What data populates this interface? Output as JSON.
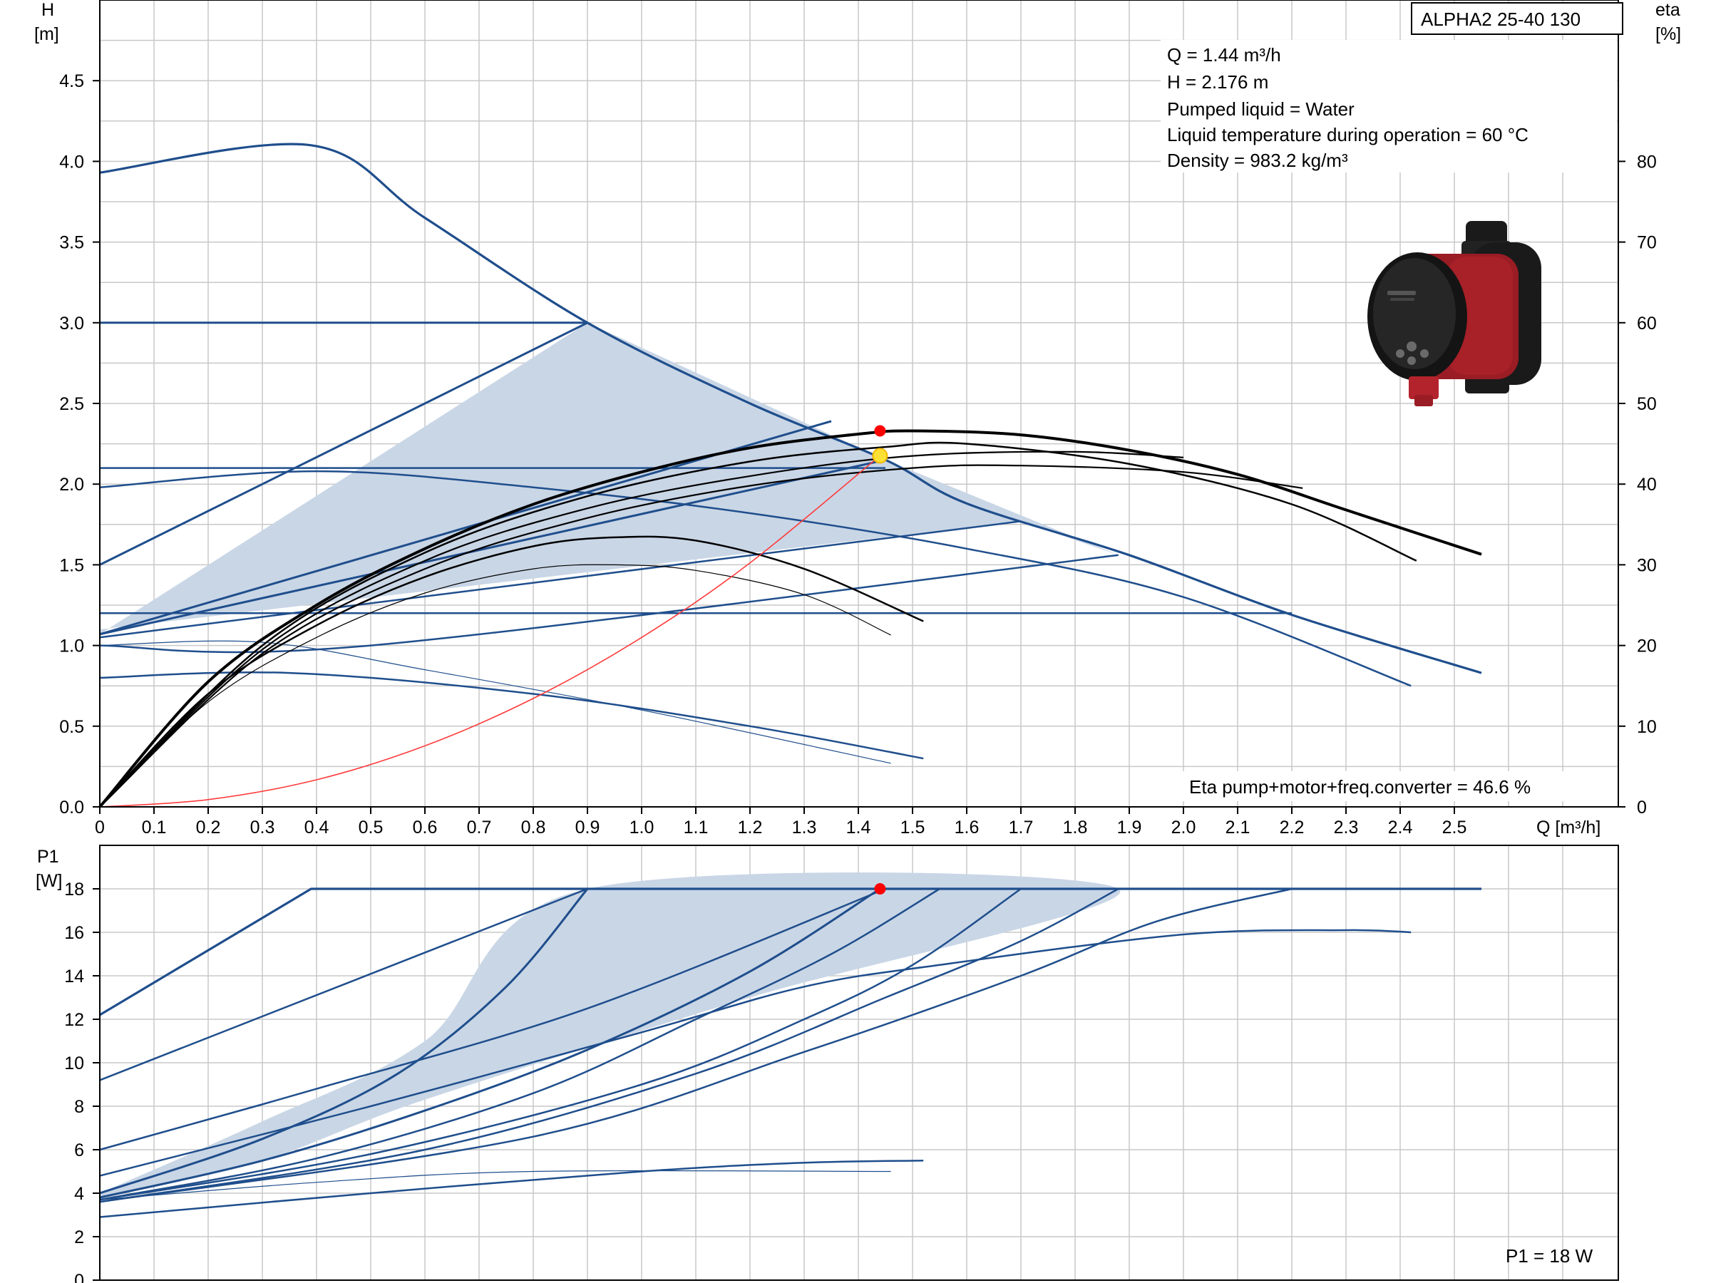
{
  "model_label": "ALPHA2 25-40 130",
  "info_lines": [
    "Q = 1.44 m³/h",
    "H = 2.176 m",
    "Pumped liquid = Water",
    "Liquid temperature during operation = 60 °C",
    "Density = 983.2 kg/m³"
  ],
  "eta_note": "Eta pump+motor+freq.converter = 46.6 %",
  "p1_note": "P1 = 18 W",
  "colors": {
    "curve_blue": "#1f4e8c",
    "shade_fill": "#c9d6e6",
    "eta_black": "#000000",
    "system_red": "#ff3b3b",
    "point_red": "#ff0000",
    "point_yellow": "#ffe135",
    "grid": "#c8c8c8"
  },
  "pump_image": {
    "icon": "circulator-pump-image",
    "body_color": "#9a1c24",
    "housing_color": "#1a1a1a"
  },
  "chart_data": [
    {
      "type": "line",
      "name": "head",
      "ylabel_line1": "H",
      "ylabel_line2": "[m]",
      "y2label_line1": "eta",
      "y2label_line2": "[%]",
      "xlabel": "Q [m³/h]",
      "xlim": [
        0,
        2.8
      ],
      "ylim": [
        0,
        5.0
      ],
      "y2lim": [
        0,
        100
      ],
      "xticks": [
        0,
        0.1,
        0.2,
        0.3,
        0.4,
        0.5,
        0.6,
        0.7,
        0.8,
        0.9,
        1.0,
        1.1,
        1.2,
        1.3,
        1.4,
        1.5,
        1.6,
        1.7,
        1.8,
        1.9,
        2.0,
        2.1,
        2.2,
        2.3,
        2.4,
        2.5
      ],
      "xtick_labels": [
        "0",
        "0.1",
        "0.2",
        "0.3",
        "0.4",
        "0.5",
        "0.6",
        "0.7",
        "0.8",
        "0.9",
        "1.0",
        "1.1",
        "1.2",
        "1.3",
        "1.4",
        "1.5",
        "1.6",
        "1.7",
        "1.8",
        "1.9",
        "2.0",
        "2.1",
        "2.2",
        "2.3",
        "2.4",
        "2.5"
      ],
      "yticks": [
        0,
        0.5,
        1.0,
        1.5,
        2.0,
        2.5,
        3.0,
        3.5,
        4.0,
        4.5
      ],
      "ytick_labels": [
        "0.0",
        "0.5",
        "1.0",
        "1.5",
        "2.0",
        "2.5",
        "3.0",
        "3.5",
        "4.0",
        "4.5"
      ],
      "y2ticks": [
        0,
        10,
        20,
        30,
        40,
        50,
        60,
        70,
        80
      ],
      "y2tick_labels": [
        "0",
        "10",
        "20",
        "30",
        "40",
        "50",
        "60",
        "70",
        "80"
      ],
      "shaded_region": [
        [
          0,
          1.07
        ],
        [
          0.9,
          3.0
        ],
        [
          1.45,
          2.15
        ],
        [
          1.88,
          1.56
        ],
        [
          1.7,
          1.77
        ],
        [
          0,
          1.1
        ]
      ],
      "pump_curves": [
        {
          "name": "max",
          "width": 3.2,
          "points": [
            [
              0,
              3.93
            ],
            [
              0.39,
              4.1
            ],
            [
              0.6,
              3.65
            ],
            [
              0.9,
              3.0
            ],
            [
              1.2,
              2.5
            ],
            [
              1.45,
              2.15
            ],
            [
              1.6,
              1.88
            ],
            [
              1.9,
              1.56
            ],
            [
              2.2,
              1.19
            ],
            [
              2.55,
              0.83
            ]
          ]
        },
        {
          "name": "pp",
          "width": 3,
          "points": [
            [
              0,
              1.5
            ],
            [
              0.9,
              3.0
            ]
          ]
        },
        {
          "name": "pp",
          "width": 3,
          "points": [
            [
              0,
              1.07
            ],
            [
              1.35,
              2.39
            ]
          ]
        },
        {
          "name": "pp",
          "width": 3,
          "points": [
            [
              0,
              1.07
            ],
            [
              1.45,
              2.15
            ]
          ]
        },
        {
          "name": "pp",
          "width": 2.5,
          "points": [
            [
              0,
              1.05
            ],
            [
              1.7,
              1.77
            ]
          ]
        },
        {
          "name": "pp",
          "width": 2.5,
          "points": [
            [
              0,
              1.0
            ],
            [
              0.5,
              1.0
            ],
            [
              1.88,
              1.56
            ]
          ]
        },
        {
          "name": "cp",
          "width": 3,
          "points": [
            [
              0,
              3.0
            ],
            [
              0.9,
              3.0
            ]
          ]
        },
        {
          "name": "cp",
          "width": 2.5,
          "points": [
            [
              0,
              2.1
            ],
            [
              1.45,
              2.1
            ]
          ]
        },
        {
          "name": "cp",
          "width": 2.5,
          "points": [
            [
              0,
              1.2
            ],
            [
              2.2,
              1.2
            ]
          ]
        },
        {
          "name": "cp-curve",
          "width": 2.5,
          "points": [
            [
              0,
              1.98
            ],
            [
              0.4,
              2.08
            ],
            [
              0.8,
              1.98
            ],
            [
              1.2,
              1.82
            ],
            [
              1.6,
              1.6
            ],
            [
              2.0,
              1.3
            ],
            [
              2.42,
              0.75
            ]
          ]
        },
        {
          "name": "min",
          "width": 2.5,
          "points": [
            [
              0,
              0.8
            ],
            [
              0.35,
              0.83
            ],
            [
              0.8,
              0.7
            ],
            [
              1.2,
              0.5
            ],
            [
              1.52,
              0.3
            ]
          ]
        },
        {
          "name": "min-thin",
          "width": 1.2,
          "points": [
            [
              0,
              1.0
            ],
            [
              0.3,
              1.02
            ],
            [
              0.6,
              0.85
            ],
            [
              1.0,
              0.6
            ],
            [
              1.46,
              0.27
            ]
          ]
        }
      ],
      "eta_curves": [
        {
          "width": 4,
          "points": [
            [
              0,
              0
            ],
            [
              0.2,
              15.5
            ],
            [
              0.4,
              25
            ],
            [
              0.6,
              32
            ],
            [
              0.8,
              37.5
            ],
            [
              1.0,
              41.5
            ],
            [
              1.2,
              44.5
            ],
            [
              1.4,
              46.2
            ],
            [
              1.5,
              46.6
            ],
            [
              1.7,
              46.1
            ],
            [
              1.9,
              44.2
            ],
            [
              2.1,
              41.2
            ],
            [
              2.3,
              36.8
            ],
            [
              2.55,
              31.3
            ]
          ]
        },
        {
          "width": 2.5,
          "points": [
            [
              0,
              0
            ],
            [
              0.3,
              20
            ],
            [
              0.6,
              31.5
            ],
            [
              0.9,
              38.5
            ],
            [
              1.2,
              42.8
            ],
            [
              1.45,
              44.6
            ],
            [
              1.6,
              45
            ],
            [
              1.9,
              42.5
            ],
            [
              2.2,
              37.5
            ],
            [
              2.43,
              30.5
            ]
          ]
        },
        {
          "width": 2.2,
          "points": [
            [
              0,
              0
            ],
            [
              0.3,
              19.5
            ],
            [
              0.6,
              30.5
            ],
            [
              0.9,
              37
            ],
            [
              1.2,
              41
            ],
            [
              1.5,
              43.5
            ],
            [
              1.8,
              44
            ],
            [
              2.0,
              43.3
            ]
          ]
        },
        {
          "width": 2.2,
          "points": [
            [
              0,
              0
            ],
            [
              0.3,
              19
            ],
            [
              0.6,
              29.5
            ],
            [
              0.9,
              35.8
            ],
            [
              1.2,
              39.8
            ],
            [
              1.5,
              42
            ],
            [
              1.7,
              42.3
            ],
            [
              2.0,
              41.5
            ],
            [
              2.22,
              39.5
            ]
          ]
        },
        {
          "width": 2.5,
          "points": [
            [
              0,
              0
            ],
            [
              0.2,
              14
            ],
            [
              0.4,
              22.5
            ],
            [
              0.6,
              28.5
            ],
            [
              0.8,
              32.3
            ],
            [
              0.95,
              33.4
            ],
            [
              1.1,
              33
            ],
            [
              1.3,
              29.5
            ],
            [
              1.52,
              23
            ]
          ]
        },
        {
          "width": 1.2,
          "points": [
            [
              0,
              0
            ],
            [
              0.2,
              13
            ],
            [
              0.4,
              21
            ],
            [
              0.6,
              26.5
            ],
            [
              0.8,
              29.5
            ],
            [
              0.95,
              30
            ],
            [
              1.1,
              29.3
            ],
            [
              1.3,
              26.3
            ],
            [
              1.46,
              21.3
            ]
          ]
        }
      ],
      "system_curve": [
        [
          0,
          0
        ],
        [
          0.2,
          0.045
        ],
        [
          0.4,
          0.168
        ],
        [
          0.6,
          0.378
        ],
        [
          0.8,
          0.672
        ],
        [
          1.0,
          1.05
        ],
        [
          1.2,
          1.512
        ],
        [
          1.44,
          2.176
        ]
      ],
      "duty_point": {
        "q": 1.44,
        "h": 2.176
      },
      "eta_point": {
        "q": 1.44,
        "eta": 46.6
      }
    },
    {
      "type": "line",
      "name": "power",
      "ylabel_line1": "P1",
      "ylabel_line2": "[W]",
      "xlim": [
        0,
        2.8
      ],
      "ylim": [
        0,
        20
      ],
      "yticks": [
        0,
        2,
        4,
        6,
        8,
        10,
        12,
        14,
        16,
        18
      ],
      "ytick_labels": [
        "0",
        "2",
        "4",
        "6",
        "8",
        "10",
        "12",
        "14",
        "16",
        "18"
      ],
      "shaded_region": [
        [
          0,
          4.0
        ],
        [
          0.3,
          7.3
        ],
        [
          0.6,
          11
        ],
        [
          0.9,
          18
        ],
        [
          1.88,
          18
        ],
        [
          1.2,
          13
        ],
        [
          0.6,
          8.3
        ],
        [
          0.3,
          5.5
        ],
        [
          0,
          3.8
        ]
      ],
      "power_curves": [
        {
          "name": "max",
          "width": 3.2,
          "points": [
            [
              0,
              12.2
            ],
            [
              0.39,
              18
            ],
            [
              2.55,
              18
            ]
          ]
        },
        {
          "name": "pp",
          "width": 3,
          "points": [
            [
              0,
              4.0
            ],
            [
              0.3,
              6.5
            ],
            [
              0.55,
              9.5
            ],
            [
              0.75,
              13.5
            ],
            [
              0.9,
              18
            ]
          ]
        },
        {
          "name": "pp",
          "width": 3,
          "points": [
            [
              0,
              3.8
            ],
            [
              0.3,
              5.5
            ],
            [
              0.6,
              7.8
            ],
            [
              0.9,
              10.6
            ],
            [
              1.2,
              14.2
            ],
            [
              1.44,
              18
            ]
          ]
        },
        {
          "name": "pp",
          "width": 2.5,
          "points": [
            [
              0,
              3.7
            ],
            [
              0.4,
              5.6
            ],
            [
              0.8,
              8.6
            ],
            [
              1.1,
              12
            ],
            [
              1.35,
              15
            ],
            [
              1.55,
              18
            ]
          ]
        },
        {
          "name": "pp",
          "width": 2.5,
          "points": [
            [
              0,
              3.7
            ],
            [
              0.5,
              5.8
            ],
            [
              1.0,
              9.0
            ],
            [
              1.3,
              12
            ],
            [
              1.5,
              14.5
            ],
            [
              1.7,
              18
            ]
          ]
        },
        {
          "name": "pp",
          "width": 2.5,
          "points": [
            [
              0,
              3.6
            ],
            [
              0.6,
              6.0
            ],
            [
              1.1,
              9.5
            ],
            [
              1.45,
              13
            ],
            [
              1.7,
              15.6
            ],
            [
              1.88,
              18
            ]
          ]
        },
        {
          "name": "pp",
          "width": 2.5,
          "points": [
            [
              0,
              3.6
            ],
            [
              0.8,
              6.6
            ],
            [
              1.3,
              10.5
            ],
            [
              1.7,
              14
            ],
            [
              1.95,
              16.5
            ],
            [
              2.2,
              18
            ]
          ]
        },
        {
          "name": "cp",
          "width": 2.5,
          "points": [
            [
              0,
              9.2
            ],
            [
              0.9,
              18
            ]
          ]
        },
        {
          "name": "cp",
          "width": 2.5,
          "points": [
            [
              0,
              6.0
            ],
            [
              0.4,
              8.8
            ],
            [
              0.9,
              12.5
            ],
            [
              1.45,
              18
            ]
          ]
        },
        {
          "name": "cp",
          "width": 2.5,
          "points": [
            [
              0,
              4.8
            ],
            [
              0.5,
              8.0
            ],
            [
              1.0,
              11.4
            ],
            [
              1.3,
              13.5
            ],
            [
              1.55,
              14.5
            ],
            [
              2.0,
              15.9
            ],
            [
              2.3,
              16.1
            ],
            [
              2.42,
              16
            ]
          ]
        },
        {
          "name": "min",
          "width": 2.5,
          "points": [
            [
              0,
              2.9
            ],
            [
              0.5,
              4.0
            ],
            [
              1.0,
              5.0
            ],
            [
              1.3,
              5.4
            ],
            [
              1.52,
              5.5
            ]
          ]
        },
        {
          "name": "min-thin",
          "width": 1.2,
          "points": [
            [
              0,
              3.7
            ],
            [
              0.4,
              4.5
            ],
            [
              0.8,
              5.0
            ],
            [
              1.46,
              5.0
            ]
          ]
        }
      ],
      "duty_point": {
        "q": 1.44,
        "p1": 18
      }
    }
  ]
}
